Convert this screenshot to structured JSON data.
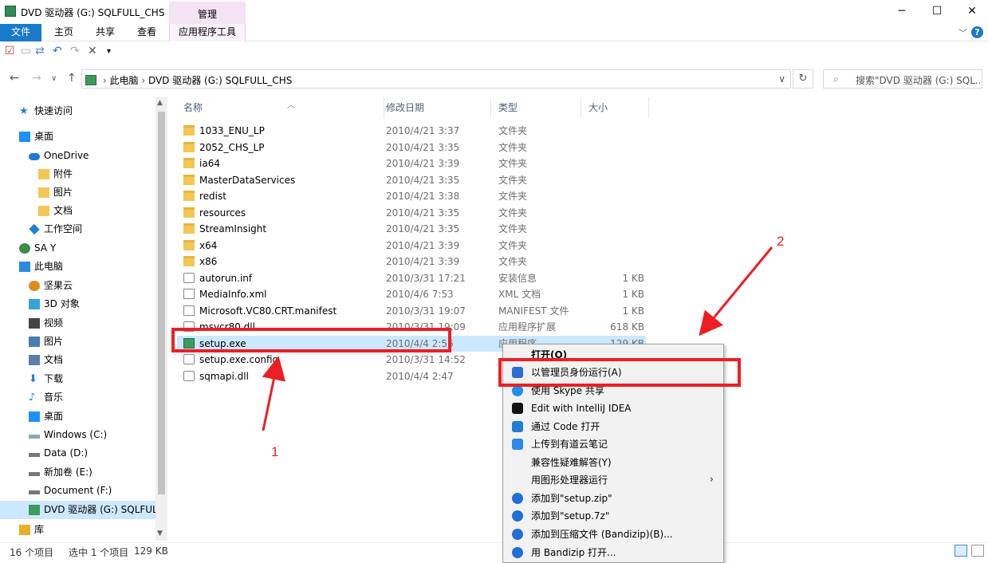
{
  "window": {
    "title": "DVD 驱动器 (G:) SQLFULL_CHS",
    "context_tab_header": "管理",
    "controls": [
      "─",
      "☐",
      "✕"
    ]
  },
  "ribbon": {
    "tabs": [
      "文件",
      "主页",
      "共享",
      "查看"
    ],
    "context_tab": "应用程序工具",
    "help": "?"
  },
  "address_bar": {
    "crumbs": [
      "此电脑",
      "DVD 驱动器 (G:) SQLFULL_CHS"
    ],
    "search_placeholder": "搜索\"DVD 驱动器 (G:) SQL..."
  },
  "nav_pane": [
    {
      "label": "快速访问",
      "icon": "star-icon",
      "color": "#1e7fd8"
    },
    {
      "label": "桌面",
      "icon": "desktop-icon",
      "color": "#1e90ff"
    },
    {
      "label": "OneDrive",
      "icon": "cloud-icon",
      "color": "#1e78d6"
    },
    {
      "label": "附件",
      "icon": "folder-icon",
      "color": "#f4c754"
    },
    {
      "label": "图片",
      "icon": "folder-icon",
      "color": "#f4c754"
    },
    {
      "label": "文档",
      "icon": "folder-icon",
      "color": "#f4c754"
    },
    {
      "label": "工作空间",
      "icon": "diamond-icon",
      "color": "#1e7fd8"
    },
    {
      "label": "SA Y",
      "icon": "user-icon",
      "color": "#3c8c4a"
    },
    {
      "label": "此电脑",
      "icon": "computer-icon",
      "color": "#2b8ae0"
    },
    {
      "label": "坚果云",
      "icon": "nut-icon",
      "color": "#e08a1e"
    },
    {
      "label": "3D 对象",
      "icon": "cube-icon",
      "color": "#35a3d8"
    },
    {
      "label": "视频",
      "icon": "video-icon",
      "color": "#444"
    },
    {
      "label": "图片",
      "icon": "pictures-icon",
      "color": "#4a7db3"
    },
    {
      "label": "文档",
      "icon": "documents-icon",
      "color": "#5b7fa8"
    },
    {
      "label": "下载",
      "icon": "download-icon",
      "color": "#1e7fd8"
    },
    {
      "label": "音乐",
      "icon": "music-icon",
      "color": "#1e7fd8"
    },
    {
      "label": "桌面",
      "icon": "desktop-icon",
      "color": "#1e90ff"
    },
    {
      "label": "Windows (C:)",
      "icon": "drive-icon",
      "color": "#8aa"
    },
    {
      "label": "Data (D:)",
      "icon": "drive-icon",
      "color": "#777"
    },
    {
      "label": "新加卷 (E:)",
      "icon": "drive-icon",
      "color": "#777"
    },
    {
      "label": "Document (F:)",
      "icon": "drive-icon",
      "color": "#777"
    },
    {
      "label": "DVD 驱动器 (G:) SQLFUL",
      "icon": "dvd-icon",
      "color": "#3c9a5f",
      "selected": true
    },
    {
      "label": "库",
      "icon": "library-icon",
      "color": "#e8b028"
    }
  ],
  "columns": [
    "名称",
    "修改日期",
    "类型",
    "大小"
  ],
  "files": [
    {
      "name": "1033_ENU_LP",
      "date": "2010/4/21 3:37",
      "type": "文件夹",
      "size": "",
      "kind": "folder"
    },
    {
      "name": "2052_CHS_LP",
      "date": "2010/4/21 3:35",
      "type": "文件夹",
      "size": "",
      "kind": "folder"
    },
    {
      "name": "ia64",
      "date": "2010/4/21 3:39",
      "type": "文件夹",
      "size": "",
      "kind": "folder"
    },
    {
      "name": "MasterDataServices",
      "date": "2010/4/21 3:35",
      "type": "文件夹",
      "size": "",
      "kind": "folder"
    },
    {
      "name": "redist",
      "date": "2010/4/21 3:38",
      "type": "文件夹",
      "size": "",
      "kind": "folder"
    },
    {
      "name": "resources",
      "date": "2010/4/21 3:35",
      "type": "文件夹",
      "size": "",
      "kind": "folder"
    },
    {
      "name": "StreamInsight",
      "date": "2010/4/21 3:35",
      "type": "文件夹",
      "size": "",
      "kind": "folder"
    },
    {
      "name": "x64",
      "date": "2010/4/21 3:39",
      "type": "文件夹",
      "size": "",
      "kind": "folder"
    },
    {
      "name": "x86",
      "date": "2010/4/21 3:39",
      "type": "文件夹",
      "size": "",
      "kind": "folder"
    },
    {
      "name": "autorun.inf",
      "date": "2010/3/31 17:21",
      "type": "安装信息",
      "size": "1 KB",
      "kind": "gear"
    },
    {
      "name": "MediaInfo.xml",
      "date": "2010/4/6 7:53",
      "type": "XML 文档",
      "size": "1 KB",
      "kind": "file"
    },
    {
      "name": "Microsoft.VC80.CRT.manifest",
      "date": "2010/3/31 19:07",
      "type": "MANIFEST 文件",
      "size": "1 KB",
      "kind": "file"
    },
    {
      "name": "msvcr80.dll",
      "date": "2010/3/31 19:09",
      "type": "应用程序扩展",
      "size": "618 KB",
      "kind": "gear"
    },
    {
      "name": "setup.exe",
      "date": "2010/4/4 2:56",
      "type": "应用程序",
      "size": "129 KB",
      "kind": "exe",
      "selected": true
    },
    {
      "name": "setup.exe.config",
      "date": "2010/3/31 14:52",
      "type": "",
      "size": "",
      "kind": "gear"
    },
    {
      "name": "sqmapi.dll",
      "date": "2010/4/4 2:47",
      "type": "",
      "size": "",
      "kind": "gear"
    }
  ],
  "status": {
    "count": "16 个项目",
    "selection": "选中 1 个项目",
    "size": "129 KB"
  },
  "context_menu": [
    {
      "label": "打开(O)",
      "icon": "",
      "bold": true
    },
    {
      "label": "以管理员身份运行(A)",
      "icon": "shield-icon",
      "color": "#2b6fd6"
    },
    {
      "label": "使用 Skype 共享",
      "icon": "skype-icon",
      "color": "#1e90e8"
    },
    {
      "label": "Edit with IntelliJ IDEA",
      "icon": "intellij-icon",
      "color": "#111"
    },
    {
      "label": "通过 Code 打开",
      "icon": "vscode-icon",
      "color": "#1f7ed6"
    },
    {
      "label": "上传到有道云笔记",
      "icon": "note-icon",
      "color": "#2b8ae6"
    },
    {
      "label": "兼容性疑难解答(Y)",
      "icon": "",
      "color": ""
    },
    {
      "label": "用图形处理器运行",
      "icon": "",
      "color": "",
      "submenu": true
    },
    {
      "label": "添加到\"setup.zip\"",
      "icon": "bandizip-icon",
      "color": "#1f6fd6"
    },
    {
      "label": "添加到\"setup.7z\"",
      "icon": "bandizip-icon",
      "color": "#1f6fd6"
    },
    {
      "label": "添加到压缩文件 (Bandizip)(B)...",
      "icon": "bandizip-icon",
      "color": "#1f6fd6"
    },
    {
      "label": "用 Bandizip 打开...",
      "icon": "bandizip-icon",
      "color": "#1f6fd6"
    }
  ],
  "annotations": {
    "label_1": "1",
    "label_2": "2",
    "color": "#ee1e24"
  }
}
